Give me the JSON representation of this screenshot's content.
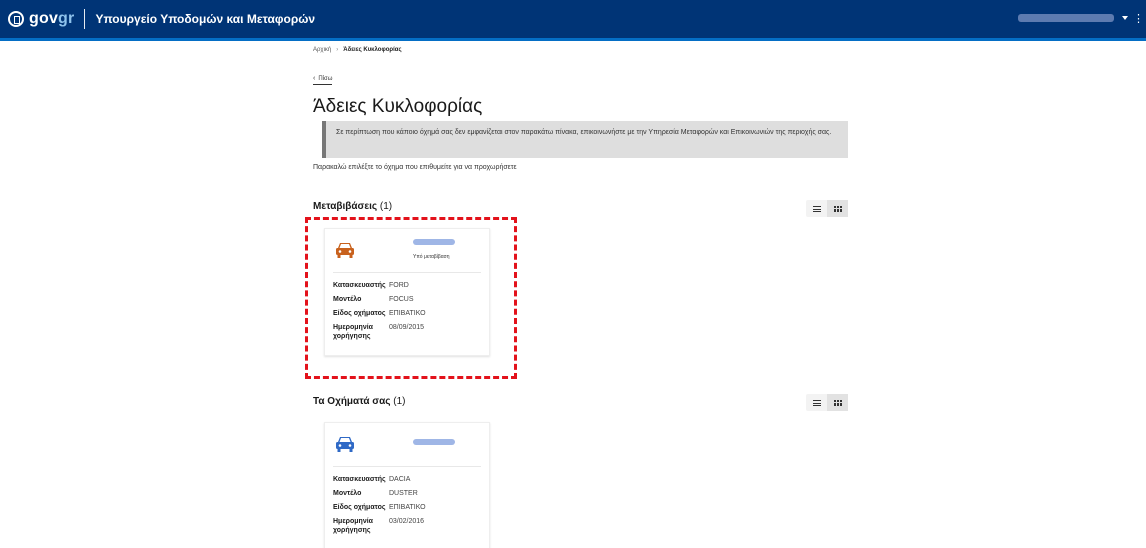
{
  "header": {
    "logo_gov": "gov",
    "logo_gr": "gr",
    "ministry": "Υπουργείο Υποδομών και Μεταφορών"
  },
  "breadcrumb": {
    "home": "Αρχική",
    "separator": "›",
    "current": "Άδειες Κυκλοφορίας"
  },
  "back_link": "Πίσω",
  "page_title": "Άδειες Κυκλοφορίας",
  "notice": "Σε περίπτωση που κάποιο όχημά σας δεν εμφανίζεται στον παρακάτω πίνακα, επικοινωνήστε με την Υπηρεσία Μεταφορών και Επικοινωνιών της περιοχής σας.",
  "instructions": "Παρακαλώ επιλέξτε το όχημα που επιθυμείτε για να προχωρήσετε",
  "sections": [
    {
      "title": "Μεταβιβάσεις",
      "count": "(1)",
      "card": {
        "icon": "car-icon",
        "icon_color": "#c8611d",
        "status": "Υπό μεταβίβαση",
        "rows": [
          {
            "key": "Κατασκευαστής",
            "value": "FORD"
          },
          {
            "key": "Μοντέλο",
            "value": "FOCUS"
          },
          {
            "key": "Είδος οχήματος",
            "value": "ΕΠΙΒΑΤΙΚΟ"
          },
          {
            "key": "Ημερομηνία χορήγησης",
            "value": "08/09/2015"
          }
        ]
      }
    },
    {
      "title": "Τα Οχήματά σας",
      "count": "(1)",
      "card": {
        "icon": "car-icon",
        "icon_color": "#2f69c6",
        "status": "",
        "rows": [
          {
            "key": "Κατασκευαστής",
            "value": "DACIA"
          },
          {
            "key": "Μοντέλο",
            "value": "DUSTER"
          },
          {
            "key": "Είδος οχήματος",
            "value": "ΕΠΙΒΑΤΙΚΟ"
          },
          {
            "key": "Ημερομηνία χορήγησης",
            "value": "03/02/2016"
          }
        ]
      }
    }
  ],
  "colors": {
    "header_bg": "#003476",
    "highlight": "#e3121b"
  }
}
